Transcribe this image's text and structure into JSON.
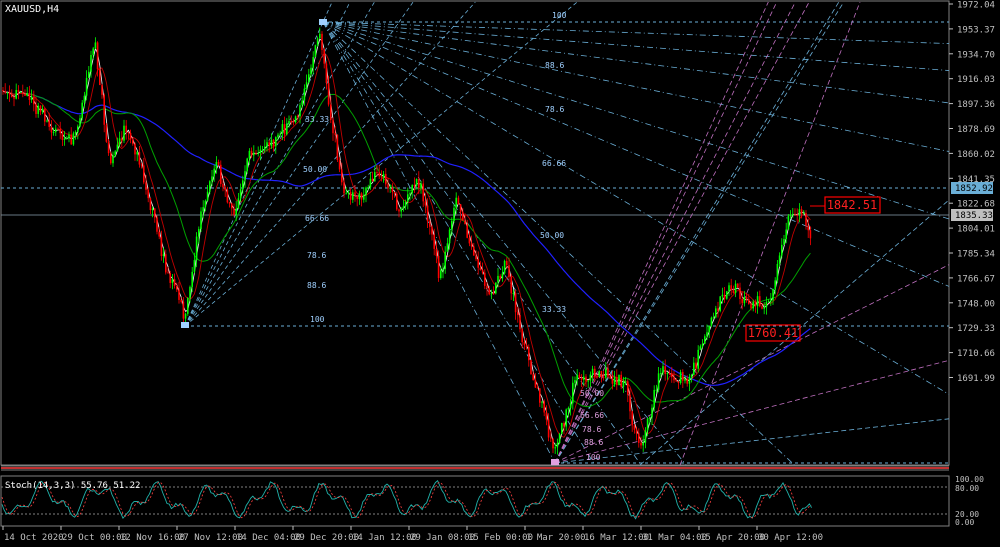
{
  "window_title": "XAUUSD,H4",
  "symbol": "XAUUSD",
  "timeframe": "H4",
  "colors": {
    "background": "#000000",
    "bull_candle": "#00ff00",
    "bear_candle": "#ff0000",
    "fib_blue": "#6aaed6",
    "fib_magenta": "#c070c0",
    "ma_blue": "#2020ff",
    "ma_green": "#00a000",
    "ma_red": "#c00000",
    "price_label_box": "#ff0000"
  },
  "price_axis": {
    "ticks": [
      "1972.04",
      "1953.37",
      "1934.70",
      "1916.03",
      "1897.36",
      "1878.69",
      "1860.02",
      "1841.35",
      "1822.68",
      "1804.01",
      "1785.34",
      "1766.67",
      "1748.00",
      "1729.33",
      "1710.66",
      "1691.99"
    ],
    "current_price": "1835.33",
    "level_price": "1852.92"
  },
  "time_axis": {
    "ticks": [
      "14 Oct 2020",
      "29 Oct 00:00",
      "12 Nov 16:00",
      "27 Nov 12:00",
      "14 Dec 04:00",
      "29 Dec 20:00",
      "14 Jan 12:00",
      "29 Jan 08:00",
      "15 Feb 00:00",
      "1 Mar 20:00",
      "16 Mar 12:00",
      "31 Mar 04:00",
      "15 Apr 20:00",
      "30 Apr 12:00"
    ]
  },
  "annotations": {
    "high_label": "1842.51",
    "low_label": "1760.41"
  },
  "fib_fan_main": [
    "100",
    "88.6",
    "78.6",
    "66.66",
    "50.00",
    "33.33",
    "66.66",
    "78.6",
    "88.6",
    "100",
    "50.00",
    "33.33"
  ],
  "fib_fan_small": [
    "50.00",
    "66.66",
    "78.6",
    "88.6",
    "100"
  ],
  "indicator": {
    "label": "Stoch(14,3,3) 55.76 51.22",
    "levels": [
      "80.00",
      "20.00",
      "0.00",
      "100.00"
    ]
  }
}
